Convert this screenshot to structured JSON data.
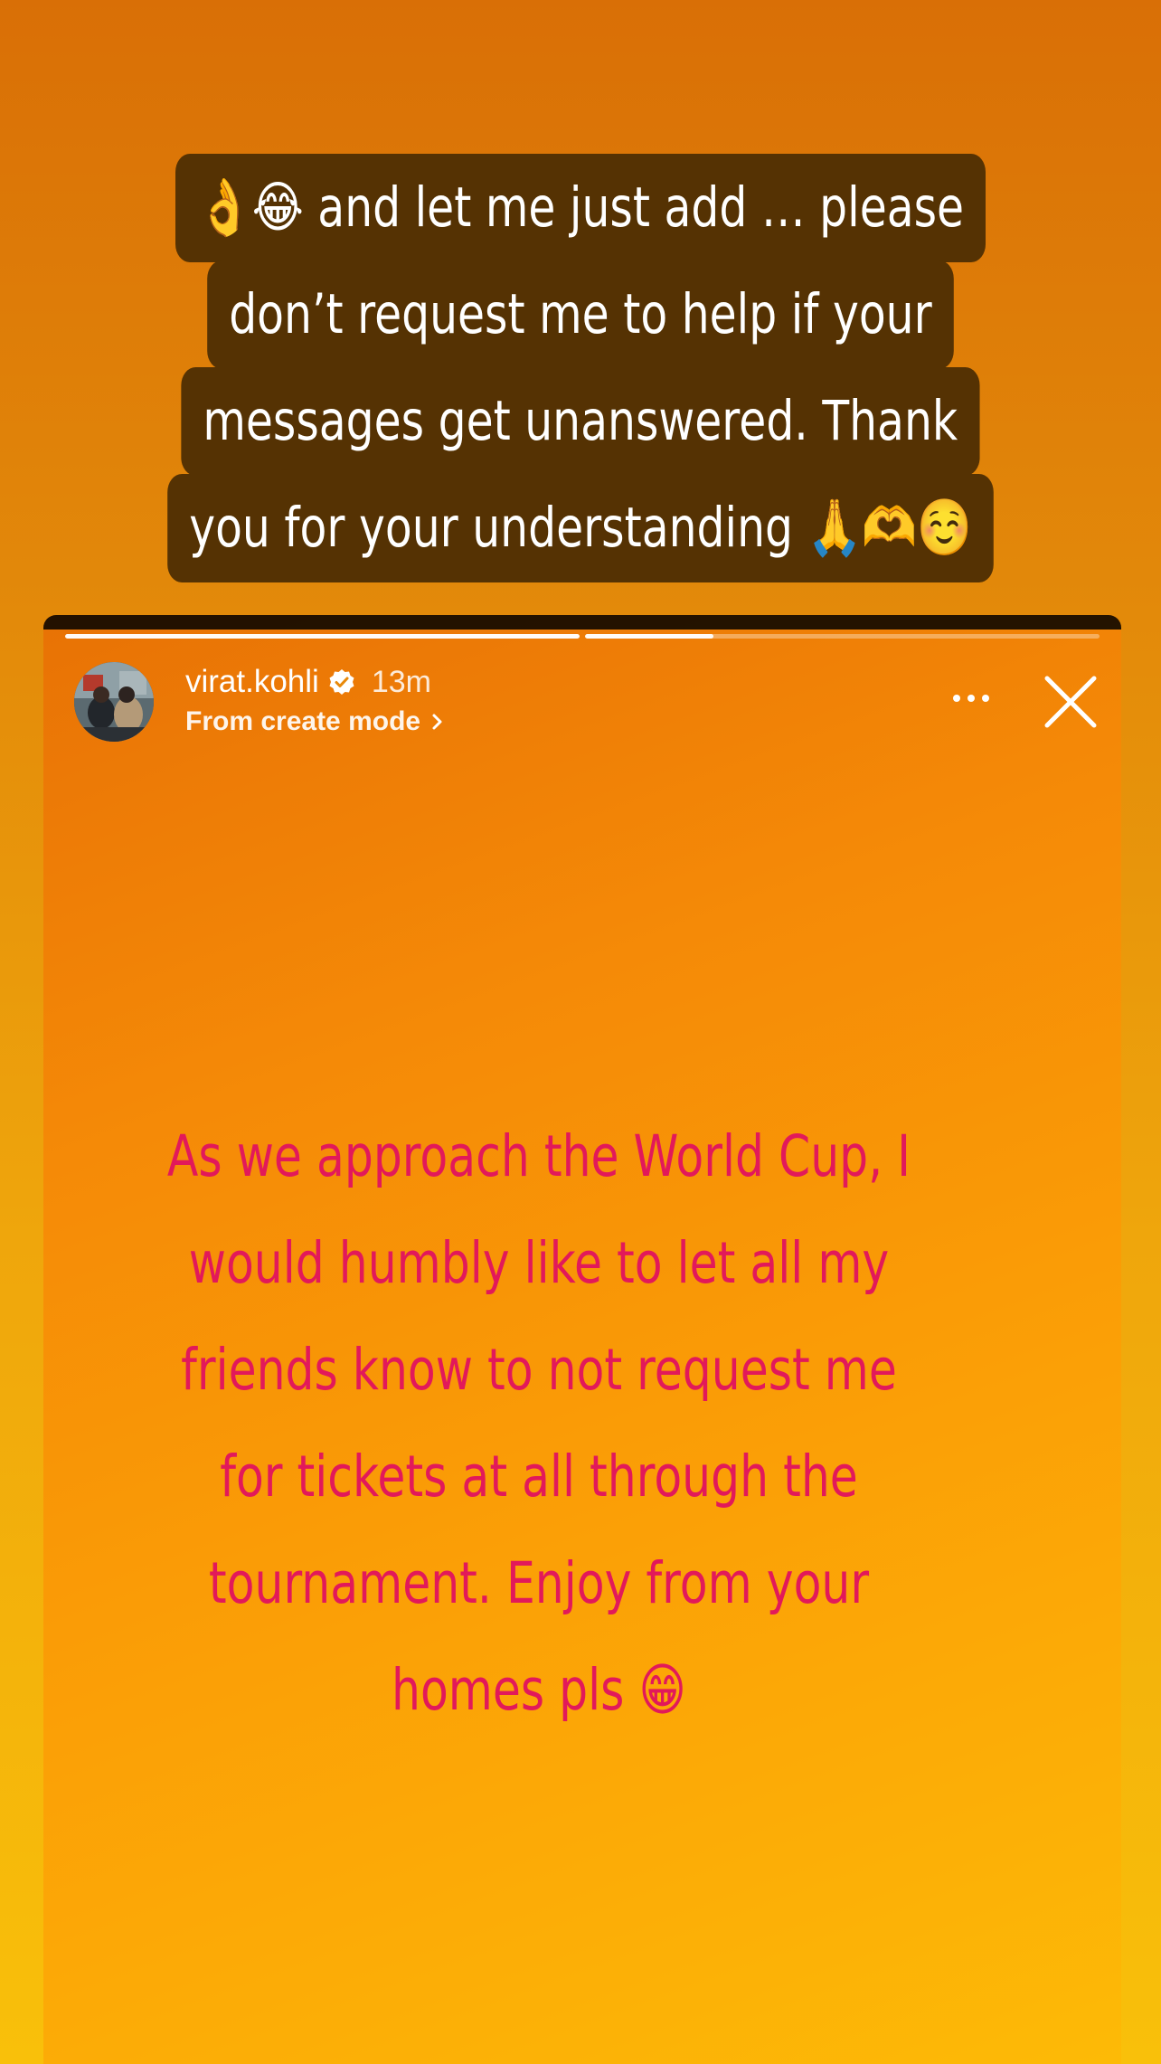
{
  "caption": {
    "lines": [
      "👌😂 and let me just add … please",
      "don’t request me to help if your",
      "messages get unanswered. Thank",
      "you for your understanding 🙏🫶☺️"
    ]
  },
  "story": {
    "progress": [
      1.0,
      0.25
    ],
    "user": {
      "username": "virat.kohli",
      "verified": true,
      "time": "13m",
      "subtitle": "From create mode"
    },
    "text_lines": [
      "As we approach the World Cup, I",
      "would humbly like to let all my",
      "friends know to not request me",
      "for tickets at all through the",
      "tournament. Enjoy from your",
      "homes pls 😁"
    ],
    "text_color": "#e2195a",
    "background_colors": [
      "#e87205",
      "#fdba06"
    ]
  },
  "icons": {
    "verified": "verified-badge-icon",
    "chevron": "chevron-right-icon",
    "more": "more-options-icon",
    "close": "close-icon"
  }
}
